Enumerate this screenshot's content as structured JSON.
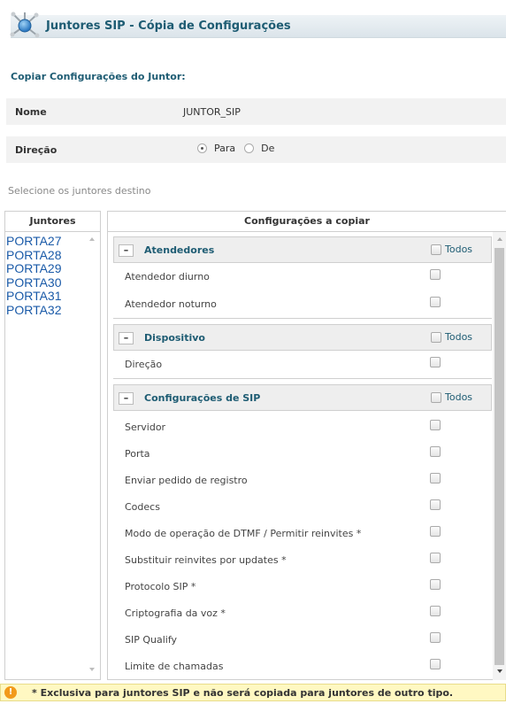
{
  "header": {
    "title": "Juntores SIP - Cópia de Configurações",
    "icon": "network-node-icon"
  },
  "form": {
    "section_title": "Copiar Configurações do Juntor:",
    "nome_label": "Nome",
    "nome_value": "JUNTOR_SIP",
    "direcao_label": "Direção",
    "options": [
      "Para",
      "De"
    ],
    "selected": "Para"
  },
  "hint": "Selecione os juntores destino",
  "juntores": {
    "header": "Juntores",
    "items": [
      "PORTA27",
      "PORTA28",
      "PORTA29",
      "PORTA30",
      "PORTA31",
      "PORTA32"
    ]
  },
  "config": {
    "header": "Configurações a copiar",
    "todos_label": "Todos",
    "collapse_symbol": "–",
    "groups": [
      {
        "title": "Atendedores",
        "items": [
          "Atendedor diurno",
          "Atendedor noturno"
        ]
      },
      {
        "title": "Dispositivo",
        "items": [
          "Direção"
        ]
      },
      {
        "title": "Configurações de SIP",
        "items": [
          "Servidor",
          "Porta",
          "Enviar pedido de registro",
          "Codecs",
          "Modo de operação de DTMF / Permitir reinvites *",
          "Substituir reinvites por updates *",
          "Protocolo SIP *",
          "Criptografia da voz *",
          "SIP Qualify",
          "Limite de chamadas"
        ]
      }
    ]
  },
  "footer": {
    "icon_symbol": "!",
    "note": "* Exclusiva para juntores SIP e não será copiada para juntores de outro tipo."
  },
  "colors": {
    "accent": "#1e5c73",
    "link": "#1a5aa8",
    "warning": "#f29a1b",
    "note_bg": "#fff8c2"
  }
}
